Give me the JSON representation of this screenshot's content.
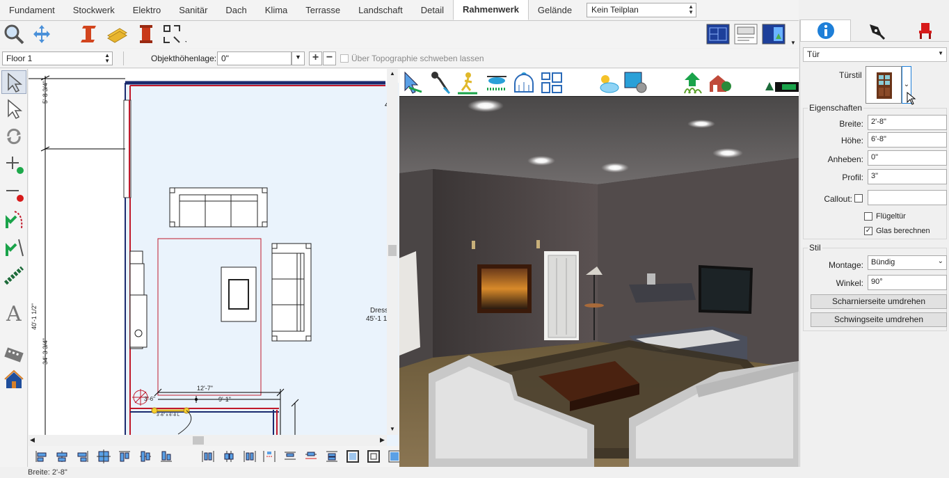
{
  "tabs": [
    {
      "label": "Fundament",
      "active": false
    },
    {
      "label": "Stockwerk",
      "active": false
    },
    {
      "label": "Elektro",
      "active": false
    },
    {
      "label": "Sanitär",
      "active": false
    },
    {
      "label": "Dach",
      "active": false
    },
    {
      "label": "Klima",
      "active": false
    },
    {
      "label": "Terrasse",
      "active": false
    },
    {
      "label": "Landschaft",
      "active": false
    },
    {
      "label": "Detail",
      "active": false
    },
    {
      "label": "Rahmenwerk",
      "active": true
    },
    {
      "label": "Gelände",
      "active": false
    }
  ],
  "teilplan": {
    "value": "Kein Teilplan"
  },
  "row2": {
    "floor": "Floor 1",
    "objekthoehe_label": "Objekthöhenlage:",
    "objekthoehe_value": "0\"",
    "schweben_label": "Über Topographie schweben lassen"
  },
  "plan": {
    "dims": {
      "left_top": "5'-8 3/4\"",
      "left_mid": "40'-1 1/2\"",
      "left_lower": "34'-3 3/4\"",
      "dim_12_7": "12'-7\"",
      "dim_9_1": "9'-1\"",
      "dim_3_6": "3'-6\"",
      "door_label": "3'-6\" x 6'-8 L",
      "dress_label": "Dress",
      "dress_size": "45'-1 1"
    }
  },
  "status": {
    "text": "Breite: 2'-8\""
  },
  "panel": {
    "type_select": "Tür",
    "tuerstil_label": "Türstil",
    "eigenschaften_title": "Eigenschaften",
    "props": [
      {
        "label": "Breite:",
        "value": "2'-8\""
      },
      {
        "label": "Höhe:",
        "value": "6'-8\""
      },
      {
        "label": "Anheben:",
        "value": "0\""
      },
      {
        "label": "Profil:",
        "value": "3\""
      }
    ],
    "callout_label": "Callout:",
    "callout_value": "",
    "fluegeltuer_label": "Flügeltür",
    "fluegeltuer_checked": false,
    "glas_label": "Glas berechnen",
    "glas_checked": true,
    "glas_mark": "✓",
    "stil_title": "Stil",
    "montage_label": "Montage:",
    "montage_value": "Bündig",
    "winkel_label": "Winkel:",
    "winkel_value": "90°",
    "btn_scharnier": "Scharnierseite umdrehen",
    "btn_schwing": "Schwingseite umdrehen"
  },
  "colors": {
    "accent": "#1e7fd8",
    "wall_red": "#c0182a",
    "plan_bg": "#eaf3fc"
  }
}
